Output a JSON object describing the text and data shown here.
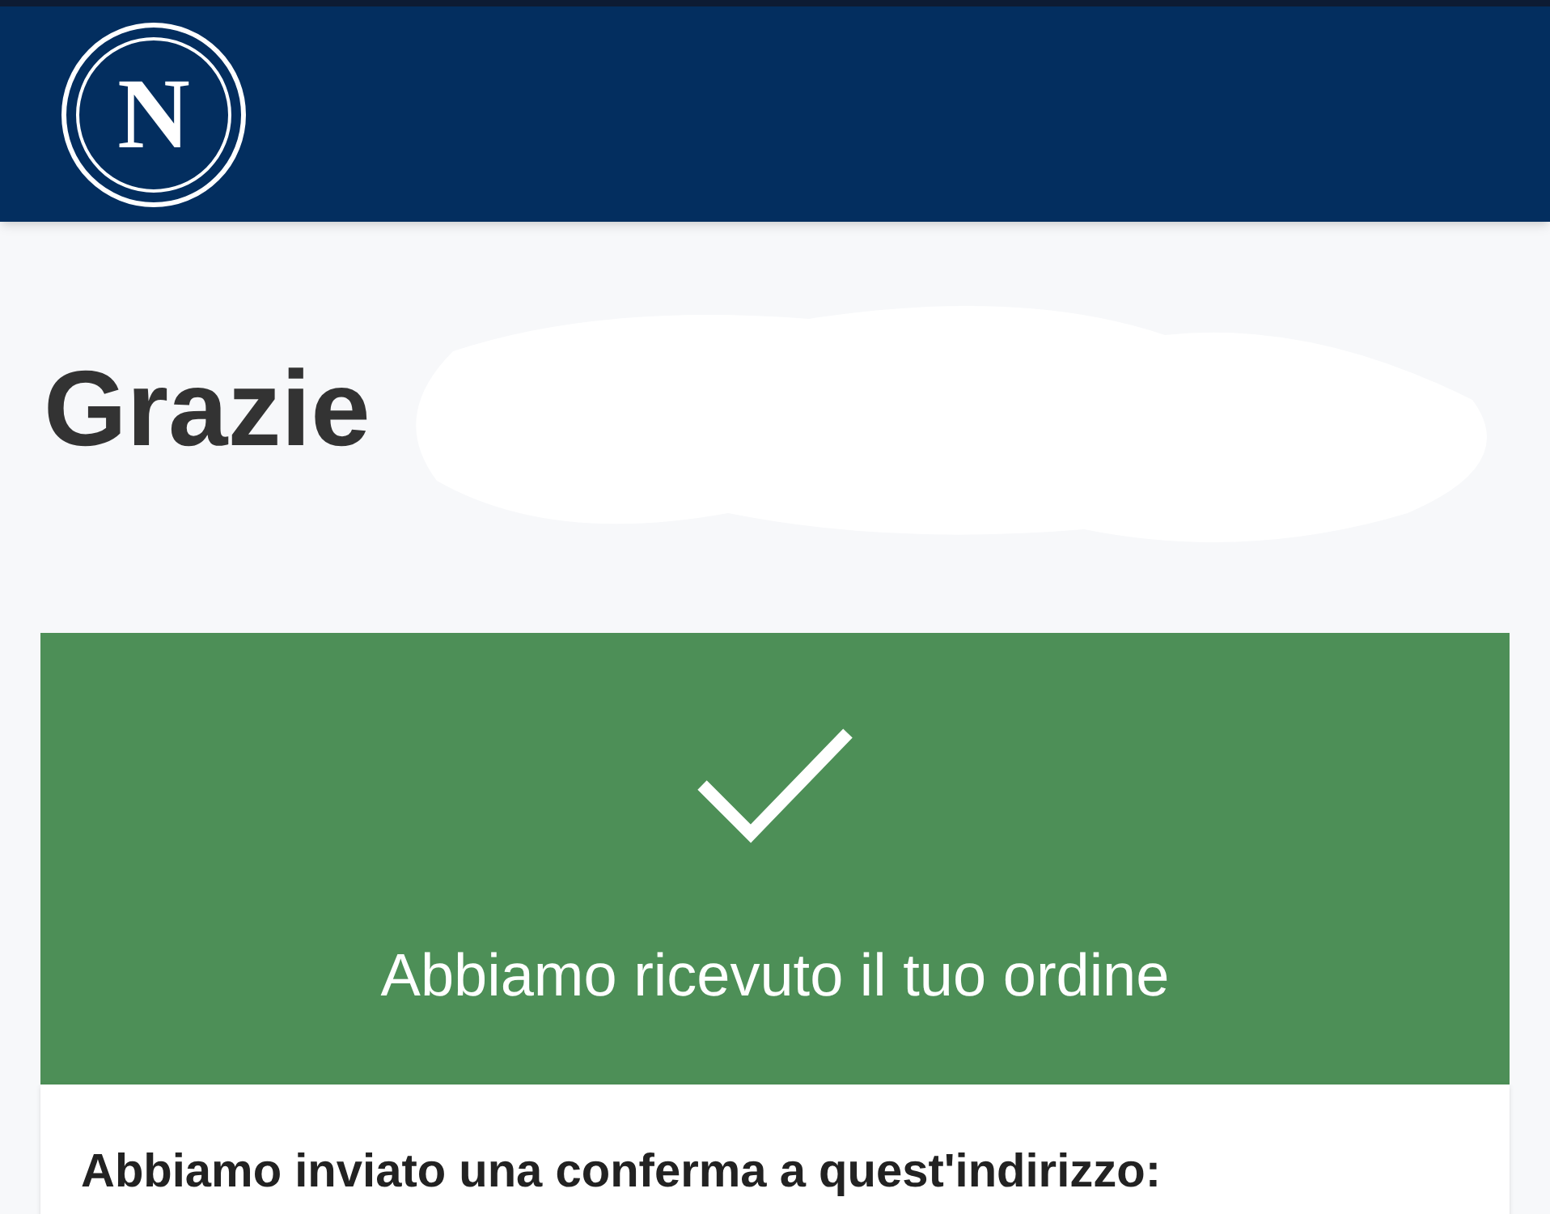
{
  "header": {
    "logo_letter": "N"
  },
  "greeting": {
    "title": "Grazie"
  },
  "confirmation": {
    "message": "Abbiamo ricevuto il tuo ordine"
  },
  "details": {
    "text": "Abbiamo inviato una conferma a quest'indirizzo:"
  }
}
